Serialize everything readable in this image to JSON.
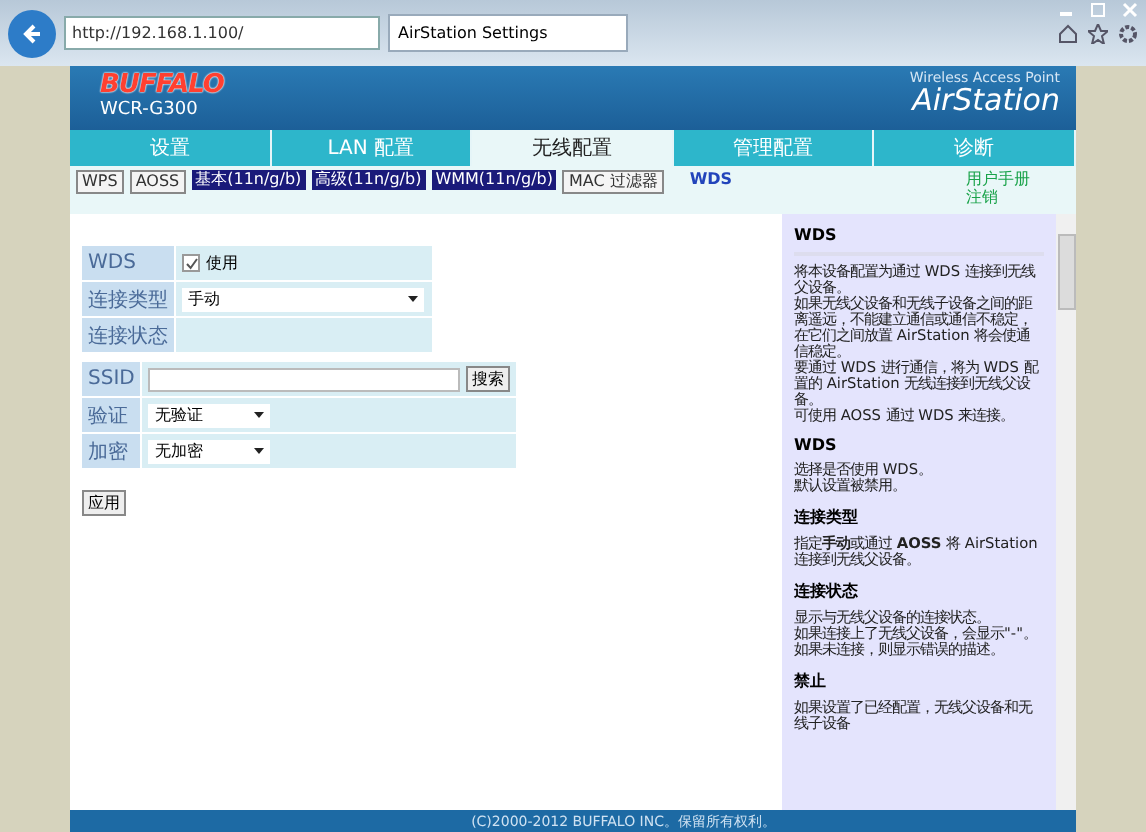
{
  "browser": {
    "address": "http://192.168.1.100/",
    "tab_title": "AirStation Settings"
  },
  "header": {
    "logo": "BUFFALO",
    "model": "WCR-G300",
    "product_caption": "Wireless Access Point",
    "product_name": "AirStation"
  },
  "tabs": [
    {
      "label": "设置",
      "selected": false
    },
    {
      "label": "LAN 配置",
      "selected": false
    },
    {
      "label": "无线配置",
      "selected": true
    },
    {
      "label": "管理配置",
      "selected": false
    },
    {
      "label": "诊断",
      "selected": false
    }
  ],
  "subnav": [
    {
      "label": "WPS",
      "kind": "button"
    },
    {
      "label": "AOSS",
      "kind": "button"
    },
    {
      "label": "基本(11n/g/b)",
      "kind": "dark"
    },
    {
      "label": "高级(11n/g/b)",
      "kind": "dark"
    },
    {
      "label": "WMM(11n/g/b)",
      "kind": "dark"
    },
    {
      "label": "MAC 过滤器",
      "kind": "button"
    },
    {
      "label": "WDS",
      "kind": "current"
    }
  ],
  "top_links": [
    "用户手册",
    "注销"
  ],
  "wds_section": [
    {
      "label": "WDS",
      "kind": "checkbox",
      "checked": true,
      "value": "使用"
    },
    {
      "label": "连接类型",
      "kind": "select",
      "value": "手动"
    },
    {
      "label": "连接状态",
      "kind": "text"
    }
  ],
  "ssid_section": [
    {
      "label": "SSID",
      "kind": "search",
      "button": "搜索"
    },
    {
      "label": "验证",
      "kind": "select",
      "value": "无验证"
    },
    {
      "label": "加密",
      "kind": "select",
      "value": "无加密"
    }
  ],
  "apply_button": "应用",
  "help": [
    {
      "heading": "WDS",
      "paragraphs": [
        "将本设备配置为通过 WDS 连接到无线父设备。",
        "如果无线父设备和无线子设备之间的距离遥远，不能建立通信或通信不稳定，在它们之间放置 AirStation 将会使通信稳定。",
        "要通过 WDS 进行通信，将为 WDS 配置的 AirStation 无线连接到无线父设备。",
        "可使用 AOSS 通过 WDS 来连接。"
      ]
    },
    {
      "heading": "WDS",
      "paragraphs": [
        "选择是否使用 WDS。",
        "默认设置被禁用。"
      ]
    },
    {
      "heading": "连接类型",
      "paragraphs": [
        "指定**手动**或通过 **AOSS** 将 AirStation 连接到无线父设备。"
      ]
    },
    {
      "heading": "连接状态",
      "paragraphs": [
        "显示与无线父设备的连接状态。",
        "如果连接上了无线父设备，会显示\"-\"。",
        "如果未连接，则显示错误的描述。"
      ]
    },
    {
      "heading": "禁止",
      "paragraphs": [
        "如果设置了已经配置，无线父设备和无线子设备"
      ]
    }
  ],
  "footer": "(C)2000-2012 BUFFALO INC。保留所有权利。"
}
